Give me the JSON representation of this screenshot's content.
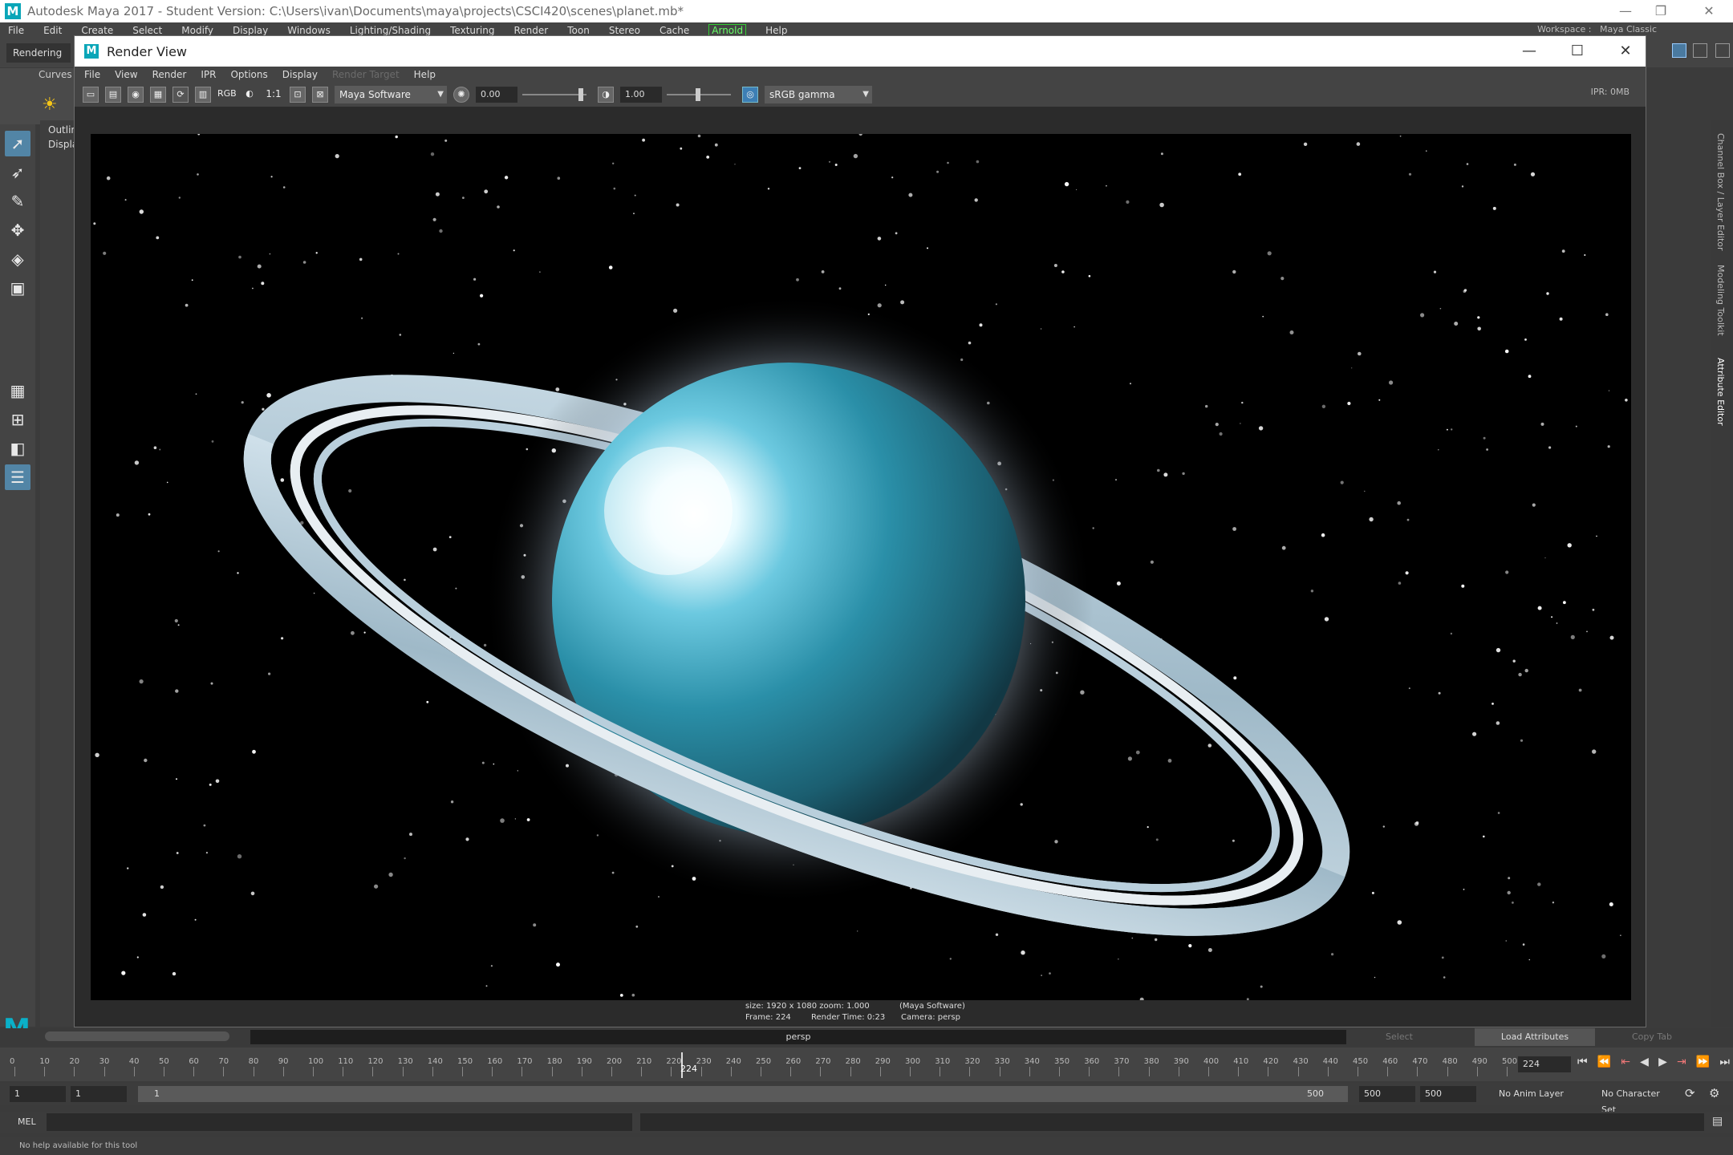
{
  "app": {
    "title": "Autodesk Maya 2017 - Student Version: C:\\Users\\ivan\\Documents\\maya\\projects\\CSCI420\\scenes\\planet.mb*",
    "logo_letter": "M",
    "menus": [
      "File",
      "Edit",
      "Create",
      "Select",
      "Modify",
      "Display",
      "Windows",
      "Lighting/Shading",
      "Texturing",
      "Render",
      "Toon",
      "Stereo",
      "Cache"
    ],
    "arnold_menu": "Arnold",
    "help_menu": "Help",
    "workspace_label": "Workspace :",
    "workspace_value": "Maya Classic",
    "mode": "Rendering",
    "shelf_tab": "Curves",
    "outliner": {
      "title": "Outlin",
      "display": "Display"
    },
    "right_tabs": [
      "Channel Box / Layer Editor",
      "Modeling Toolkit",
      "Attribute Editor"
    ]
  },
  "render_view": {
    "title": "Render View",
    "menus": [
      "File",
      "View",
      "Render",
      "IPR",
      "Options",
      "Display"
    ],
    "menu_disabled": "Render Target",
    "menu_help": "Help",
    "ratio_label": "1:1",
    "rgb_label": "RGB",
    "renderer": "Maya Software",
    "exposure": "0.00",
    "gamma": "1.00",
    "color_space": "sRGB gamma",
    "ipr_status": "IPR: 0MB",
    "info": {
      "size": "size: 1920 x 1080 zoom: 1.000",
      "renderer": "(Maya Software)",
      "frame": "Frame: 224",
      "render_time": "Render Time: 0:23",
      "camera": "Camera: persp"
    }
  },
  "viewport": {
    "camera": "persp"
  },
  "attribute_buttons": {
    "select": "Select",
    "load": "Load Attributes",
    "copy": "Copy Tab"
  },
  "timeline": {
    "ticks": [
      "0",
      "10",
      "20",
      "30",
      "40",
      "50",
      "60",
      "70",
      "80",
      "90",
      "100",
      "110",
      "120",
      "130",
      "140",
      "150",
      "160",
      "170",
      "180",
      "190",
      "200",
      "210",
      "220",
      "230",
      "240",
      "250",
      "260",
      "270",
      "280",
      "290",
      "300",
      "310",
      "320",
      "330",
      "340",
      "350",
      "360",
      "370",
      "380",
      "390",
      "400",
      "410",
      "420",
      "430",
      "440",
      "450",
      "460",
      "470",
      "480",
      "490",
      "500"
    ],
    "current_frame": "224",
    "current_frame_value": 224,
    "max_frame": 500
  },
  "range": {
    "start": "1",
    "start2": "1",
    "slider_start": "1",
    "slider_end": "500",
    "end": "500",
    "end2": "500",
    "anim_layer": "No Anim Layer",
    "char_set": "No Character Set"
  },
  "mel": {
    "label": "MEL"
  },
  "help_line": "No help available for this tool",
  "icons": [
    "maya-logo-icon",
    "minimize-icon",
    "maximize-icon",
    "close-icon",
    "select-tool-icon",
    "lasso-tool-icon",
    "paint-tool-icon",
    "move-tool-icon",
    "rotate-tool-icon",
    "scale-tool-icon",
    "sun-icon",
    "render-icon",
    "ipr-icon",
    "snapshot-icon",
    "play-icon"
  ]
}
